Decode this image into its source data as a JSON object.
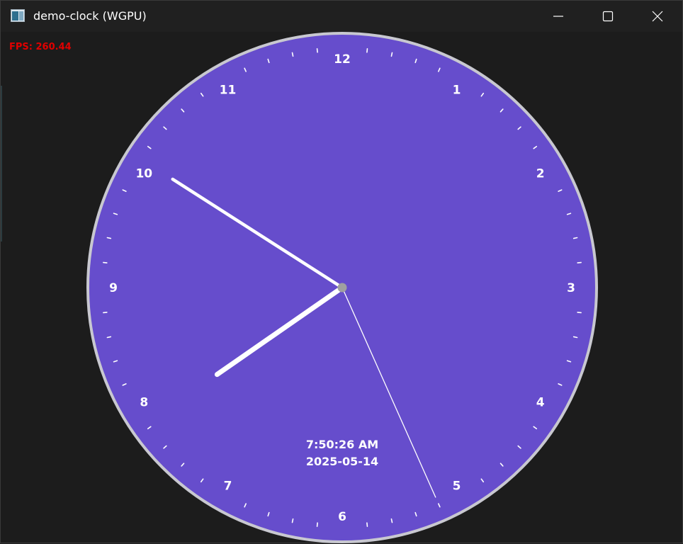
{
  "window": {
    "title": "demo-clock (WGPU)",
    "icon": "app-window-icon",
    "controls": {
      "minimize_icon": "minimize-icon",
      "maximize_icon": "maximize-icon",
      "close_icon": "close-icon"
    }
  },
  "overlay": {
    "fps_text": "FPS: 260.44",
    "fps_color": "#e00000"
  },
  "clock": {
    "face_color": "#664dcc",
    "rim_color": "#c8c8d0",
    "hand_color": "#ffffff",
    "center_cap_color": "#a0a0a0",
    "numerals": [
      "12",
      "1",
      "2",
      "3",
      "4",
      "5",
      "6",
      "7",
      "8",
      "9",
      "10",
      "11"
    ],
    "time": {
      "hours": 7,
      "minutes": 50,
      "seconds": 26
    },
    "digital_time": "7:50:26 AM",
    "digital_date": "2025-05-14"
  }
}
